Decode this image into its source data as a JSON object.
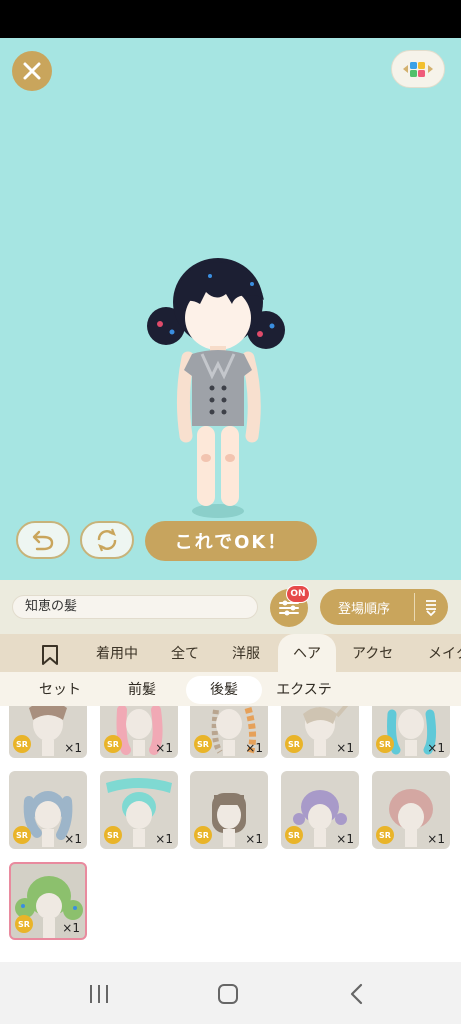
{
  "actions": {
    "ok_label": "これでOK！"
  },
  "search": {
    "value": "知恵の髪"
  },
  "filter": {
    "badge": "ON"
  },
  "sort": {
    "label": "登場順序"
  },
  "tabs": [
    {
      "label": "着用中"
    },
    {
      "label": "全て"
    },
    {
      "label": "洋服"
    },
    {
      "label": "ヘア"
    },
    {
      "label": "アクセ"
    },
    {
      "label": "メイク"
    }
  ],
  "subtabs": [
    {
      "label": "セット"
    },
    {
      "label": "前髪"
    },
    {
      "label": "後髪"
    },
    {
      "label": "エクステ"
    }
  ],
  "items": [
    {
      "rarity": "SR",
      "count": "×1"
    },
    {
      "rarity": "SR",
      "count": "×1"
    },
    {
      "rarity": "SR",
      "count": "×1"
    },
    {
      "rarity": "SR",
      "count": "×1"
    },
    {
      "rarity": "SR",
      "count": "×1"
    },
    {
      "rarity": "SR",
      "count": "×1"
    },
    {
      "rarity": "SR",
      "count": "×1"
    },
    {
      "rarity": "SR",
      "count": "×1"
    },
    {
      "rarity": "SR",
      "count": "×1"
    },
    {
      "rarity": "SR",
      "count": "×1"
    },
    {
      "rarity": "SR",
      "count": "×1"
    }
  ],
  "colors": {
    "stage_bg": "#a6e5e2",
    "accent_gold": "#c9a55c",
    "badge_red": "#e64a4a",
    "rarity_badge": "#e9b429",
    "selected_border": "#e98a9e"
  }
}
